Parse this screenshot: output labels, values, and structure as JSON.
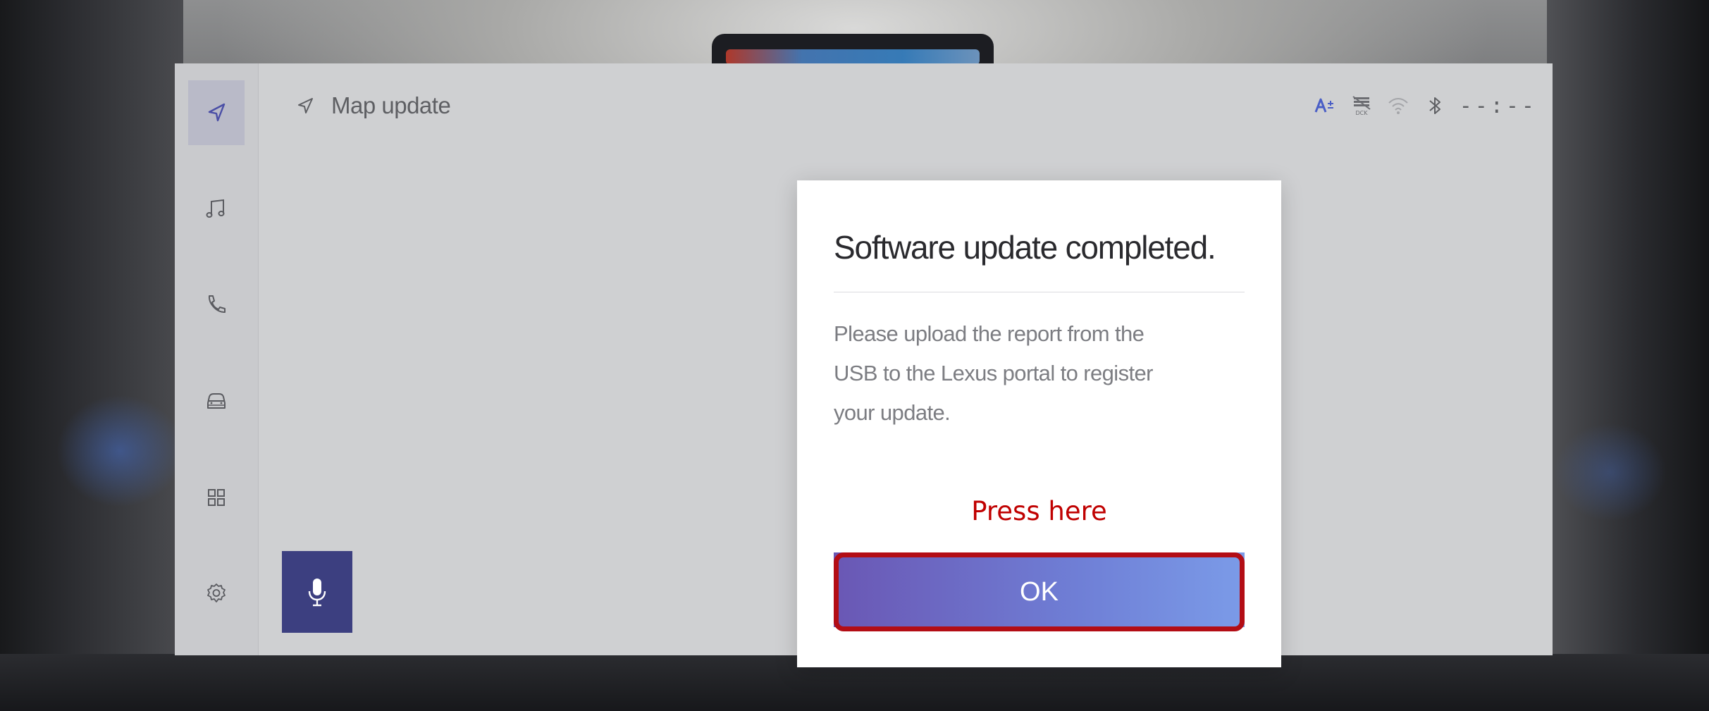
{
  "header": {
    "title": "Map update"
  },
  "status_bar": {
    "clock": "--:--",
    "icons": [
      "text-size-icon",
      "dcm-off-icon",
      "wifi-icon",
      "bluetooth-icon"
    ]
  },
  "sidebar": {
    "items": [
      {
        "icon": "navigation-icon",
        "active": true
      },
      {
        "icon": "music-icon",
        "active": false
      },
      {
        "icon": "phone-icon",
        "active": false
      },
      {
        "icon": "car-icon",
        "active": false
      },
      {
        "icon": "apps-grid-icon",
        "active": false
      },
      {
        "icon": "settings-gear-icon",
        "active": false
      }
    ]
  },
  "voice_button": {
    "icon": "microphone-icon"
  },
  "dialog": {
    "title": "Software update completed.",
    "body": "Please upload the report from the USB to the Lexus portal to register your update.",
    "annotation": "Press here",
    "ok_label": "OK"
  },
  "colors": {
    "accent": "#3c3f80",
    "active_icon": "#4a4ea6",
    "ok_gradient_start": "#6a57b4",
    "ok_gradient_end": "#7b9be8",
    "highlight_outline": "#b30d15",
    "annotation_text": "#c00000"
  }
}
